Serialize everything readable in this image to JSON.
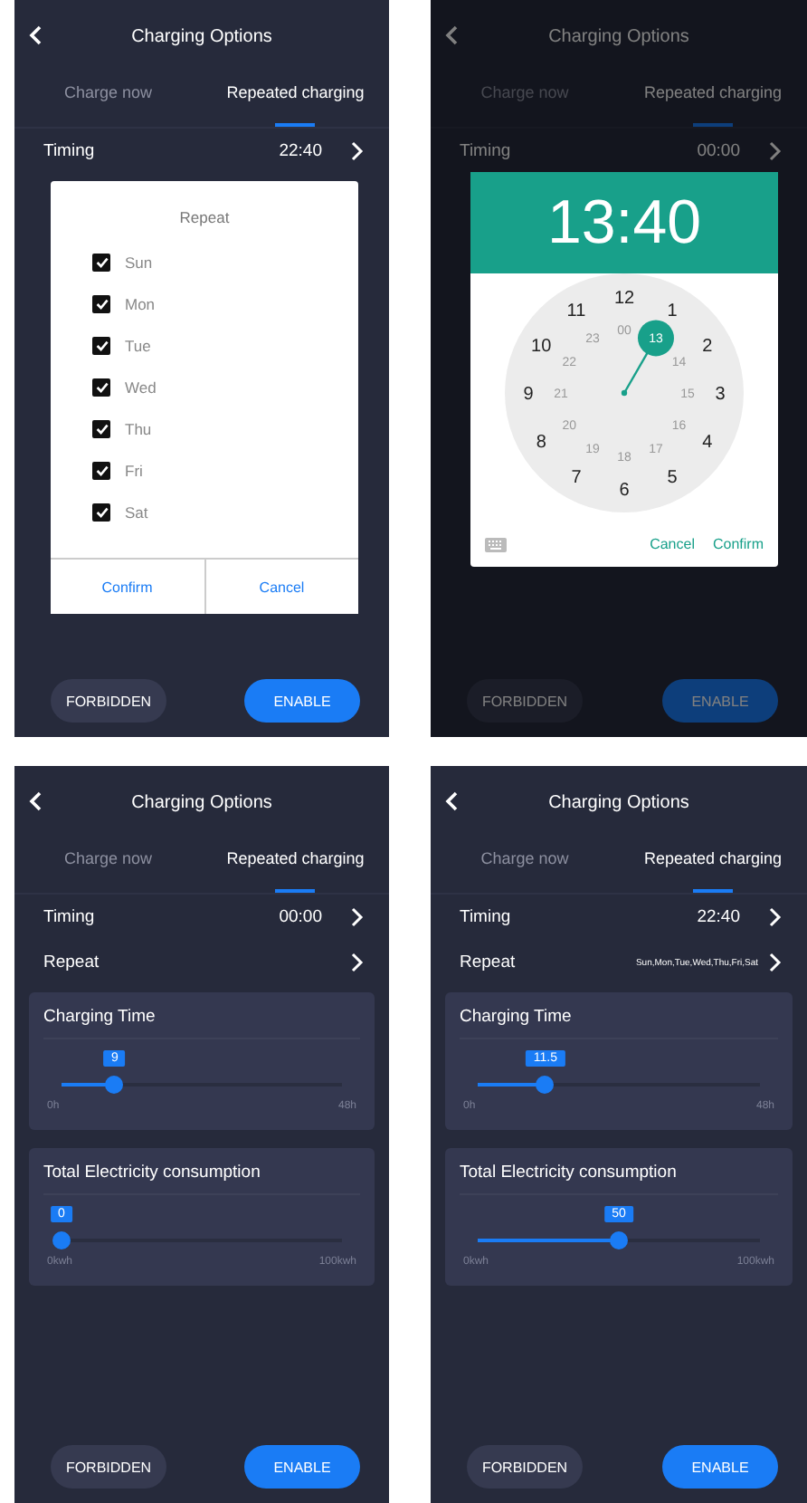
{
  "screens": [
    {
      "dimmed": false,
      "title": "Charging Options",
      "tabs": [
        {
          "label": "Charge now",
          "selected": false
        },
        {
          "label": "Repeated charging",
          "selected": true
        }
      ],
      "rows": [
        {
          "label": "Timing",
          "value": "22:40"
        }
      ],
      "buttons": [
        {
          "label": "FORBIDDEN",
          "kind": "secondary"
        },
        {
          "label": "ENABLE",
          "kind": "primary"
        }
      ],
      "dialog": {
        "kind": "repeat",
        "title": "Repeat",
        "days": [
          {
            "label": "Sun",
            "checked": true
          },
          {
            "label": "Mon",
            "checked": true
          },
          {
            "label": "Tue",
            "checked": true
          },
          {
            "label": "Wed",
            "checked": true
          },
          {
            "label": "Thu",
            "checked": true
          },
          {
            "label": "Fri",
            "checked": true
          },
          {
            "label": "Sat",
            "checked": true
          }
        ],
        "actions": [
          "Confirm",
          "Cancel"
        ]
      }
    },
    {
      "dimmed": true,
      "title": "Charging Options",
      "tabs": [
        {
          "label": "Charge now",
          "selected": false
        },
        {
          "label": "Repeated charging",
          "selected": true
        }
      ],
      "rows": [
        {
          "label": "Timing",
          "value": "00:00"
        }
      ],
      "buttons": [
        {
          "label": "FORBIDDEN",
          "kind": "secondary"
        },
        {
          "label": "ENABLE",
          "kind": "primary"
        }
      ],
      "dialog": {
        "kind": "clock",
        "time": "13:40",
        "outer": [
          {
            "label": "12",
            "selected": false
          },
          {
            "label": "1",
            "selected": false
          },
          {
            "label": "2",
            "selected": false
          },
          {
            "label": "3",
            "selected": false
          },
          {
            "label": "4",
            "selected": false
          },
          {
            "label": "5",
            "selected": false
          },
          {
            "label": "6",
            "selected": false
          },
          {
            "label": "7",
            "selected": false
          },
          {
            "label": "8",
            "selected": false
          },
          {
            "label": "9",
            "selected": false
          },
          {
            "label": "10",
            "selected": false
          },
          {
            "label": "11",
            "selected": false
          }
        ],
        "inner": [
          {
            "label": "00",
            "selected": false
          },
          {
            "label": "13",
            "selected": true
          },
          {
            "label": "14",
            "selected": false
          },
          {
            "label": "15",
            "selected": false
          },
          {
            "label": "16",
            "selected": false
          },
          {
            "label": "17",
            "selected": false
          },
          {
            "label": "18",
            "selected": false
          },
          {
            "label": "19",
            "selected": false
          },
          {
            "label": "20",
            "selected": false
          },
          {
            "label": "21",
            "selected": false
          },
          {
            "label": "22",
            "selected": false
          },
          {
            "label": "23",
            "selected": false
          }
        ],
        "actions": [
          "Cancel",
          "Confirm"
        ]
      }
    },
    {
      "dimmed": false,
      "title": "Charging Options",
      "tabs": [
        {
          "label": "Charge now",
          "selected": false
        },
        {
          "label": "Repeated charging",
          "selected": true
        }
      ],
      "rows": [
        {
          "label": "Timing",
          "value": "00:00"
        },
        {
          "label": "Repeat"
        }
      ],
      "cards": [
        {
          "title": "Charging Time",
          "value": "9",
          "level": 0.19,
          "min": "0h",
          "max": "48h"
        },
        {
          "title": "Total Electricity consumption",
          "value": "0",
          "level": 0,
          "min": "0kwh",
          "max": "100kwh"
        }
      ],
      "buttons": [
        {
          "label": "FORBIDDEN",
          "kind": "secondary"
        },
        {
          "label": "ENABLE",
          "kind": "primary"
        }
      ]
    },
    {
      "dimmed": false,
      "title": "Charging Options",
      "tabs": [
        {
          "label": "Charge now",
          "selected": false
        },
        {
          "label": "Repeated charging",
          "selected": true
        }
      ],
      "rows": [
        {
          "label": "Timing",
          "value": "22:40"
        },
        {
          "label": "Repeat",
          "value": "Sun,Mon,Tue,Wed,Thu,Fri,Sat"
        }
      ],
      "cards": [
        {
          "title": "Charging Time",
          "value": "11.5",
          "level": 0.24,
          "min": "0h",
          "max": "48h"
        },
        {
          "title": "Total Electricity consumption",
          "value": "50",
          "level": 0.5,
          "min": "0kwh",
          "max": "100kwh"
        }
      ],
      "buttons": [
        {
          "label": "FORBIDDEN",
          "kind": "secondary"
        },
        {
          "label": "ENABLE",
          "kind": "primary"
        }
      ]
    }
  ]
}
